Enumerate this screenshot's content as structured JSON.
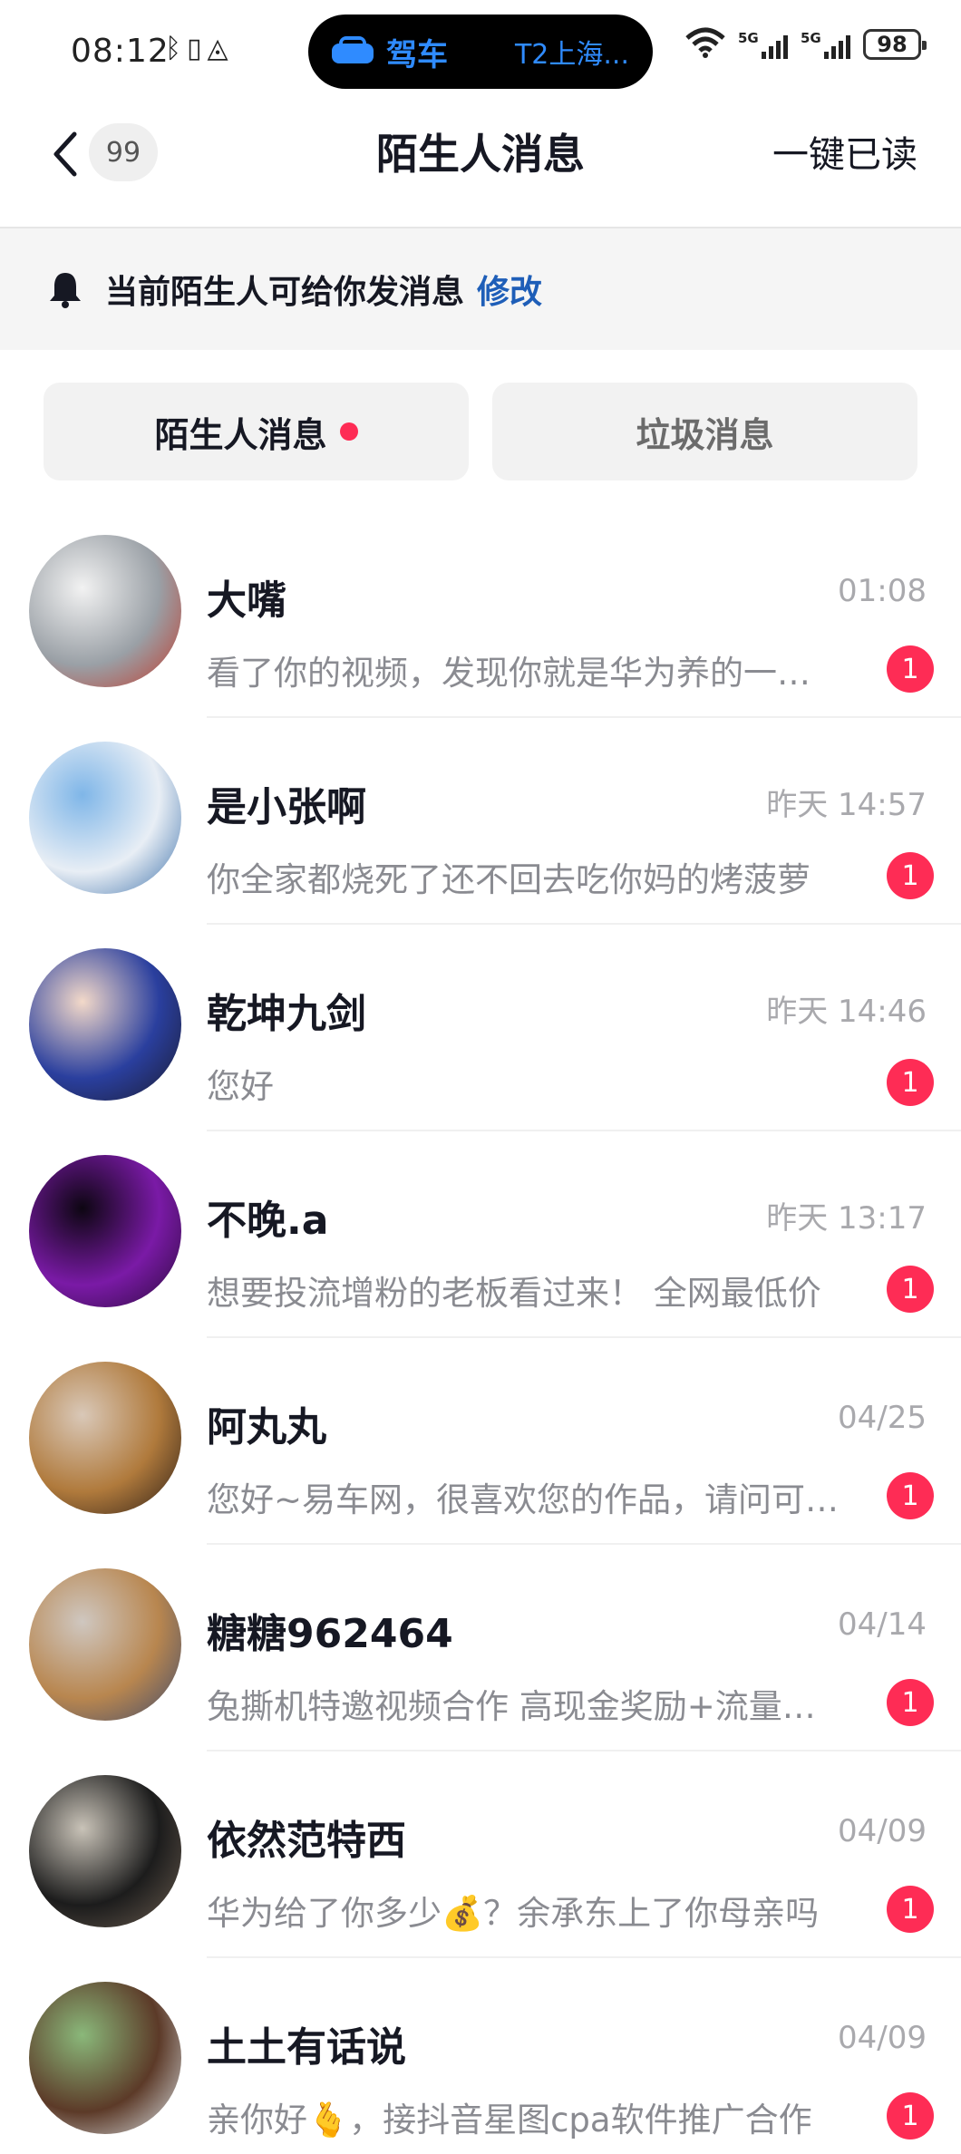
{
  "status_bar": {
    "time": "08:12",
    "left_icons": [
      "bluetooth-icon",
      "vibrate-icon",
      "location-icon"
    ],
    "island_label": "驾车",
    "island_destination": "T2上海...",
    "battery": "98",
    "network": "5G"
  },
  "header": {
    "back_count": "99",
    "title": "陌生人消息",
    "read_all": "一键已读"
  },
  "notice": {
    "text": "当前陌生人可给你发消息",
    "link": "修改"
  },
  "tabs": [
    {
      "label": "陌生人消息",
      "active": true,
      "has_dot": true
    },
    {
      "label": "垃圾消息",
      "active": false,
      "has_dot": false
    }
  ],
  "messages": [
    {
      "name": "大嘴",
      "time": "01:08",
      "preview": "看了你的视频，发现你就是华为养的一只狗",
      "unread": "1",
      "avatar_colors": [
        "#f2f2f2",
        "#9aa0a6",
        "#c0392b"
      ]
    },
    {
      "name": "是小张啊",
      "time": "昨天 14:57",
      "preview": "你全家都烧死了还不回去吃你妈的烤菠萝",
      "unread": "1",
      "avatar_colors": [
        "#7fb6e8",
        "#e8eef5",
        "#3a6ea8"
      ]
    },
    {
      "name": "乾坤九剑",
      "time": "昨天 14:46",
      "preview": "您好",
      "unread": "1",
      "avatar_colors": [
        "#f3d9c9",
        "#2a3f9e",
        "#1b1b2e"
      ]
    },
    {
      "name": "不晚.a",
      "time": "昨天 13:17",
      "preview": "想要投流增粉的老板看过来！ 全网最低价",
      "unread": "1",
      "avatar_colors": [
        "#0d0612",
        "#7a1aa6",
        "#2a0a3a"
      ]
    },
    {
      "name": "阿丸丸",
      "time": "04/25",
      "preview": "您好~易车网，很喜欢您的作品，请问可以合作吗",
      "unread": "1",
      "avatar_colors": [
        "#d9c8b8",
        "#b07a3c",
        "#2b1d16"
      ]
    },
    {
      "name": "糖糖962464",
      "time": "04/14",
      "preview": "兔撕机特邀视频合作 高现金奖励+流量扶持",
      "unread": "1",
      "avatar_colors": [
        "#cfc7c0",
        "#b8864f",
        "#3f4a6b"
      ]
    },
    {
      "name": "依然范特西",
      "time": "04/09",
      "preview": "华为给了你多少💰？余承东上了你母亲吗",
      "unread": "1",
      "avatar_colors": [
        "#c9c3b8",
        "#1c1c1c",
        "#6b5d50"
      ]
    },
    {
      "name": "土土有话说",
      "time": "04/09",
      "preview": "亲你好🫰，接抖音星图cpa软件推广合作",
      "unread": "1",
      "avatar_colors": [
        "#8ab87a",
        "#5c3a28",
        "#dfe6ea"
      ]
    }
  ]
}
